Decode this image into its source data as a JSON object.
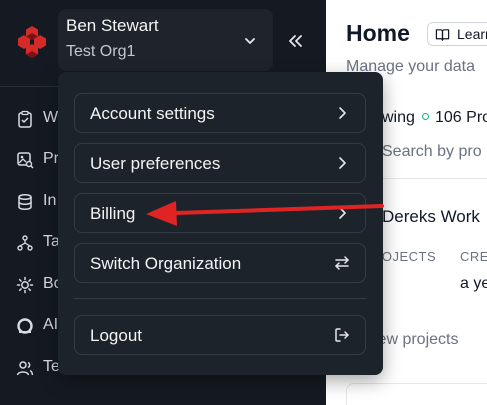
{
  "sidebar": {
    "user_name": "Ben Stewart",
    "org_name": "Test Org1",
    "nav_items": [
      {
        "label": "W",
        "icon": "clipboard-check-icon"
      },
      {
        "label": "Pr",
        "icon": "image-search-icon"
      },
      {
        "label": "In",
        "icon": "database-icon"
      },
      {
        "label": "Ta",
        "icon": "network-icon"
      },
      {
        "label": "Bo",
        "icon": "sun-settings-icon"
      },
      {
        "label": "AI",
        "icon": "ai-icon"
      },
      {
        "label": "Te",
        "icon": "users-icon"
      }
    ]
  },
  "main": {
    "title": "Home",
    "learn_button": "Learn",
    "subtitle": "Manage your data",
    "following": "wing",
    "projects_count": "106 Pro",
    "search_placeholder": "Search by pro",
    "workspace_name": "Dereks Work",
    "col_projects": "ROJECTS",
    "col_created": "CRE",
    "created_value": "a ye",
    "view_projects": "iew projects"
  },
  "dropdown": {
    "items": [
      {
        "label": "Account settings",
        "icon": "chevron-right-icon"
      },
      {
        "label": "User preferences",
        "icon": "chevron-right-icon"
      },
      {
        "label": "Billing",
        "icon": "chevron-right-icon"
      },
      {
        "label": "Switch Organization",
        "icon": "switch-arrows-icon"
      },
      {
        "label": "Logout",
        "icon": "logout-icon"
      }
    ]
  },
  "colors": {
    "sidebar_bg": "#151a22",
    "dropdown_bg": "#1d232a",
    "logo_red": "#d42a2a",
    "annotation_arrow": "#e02424",
    "status_teal": "#10b981"
  }
}
